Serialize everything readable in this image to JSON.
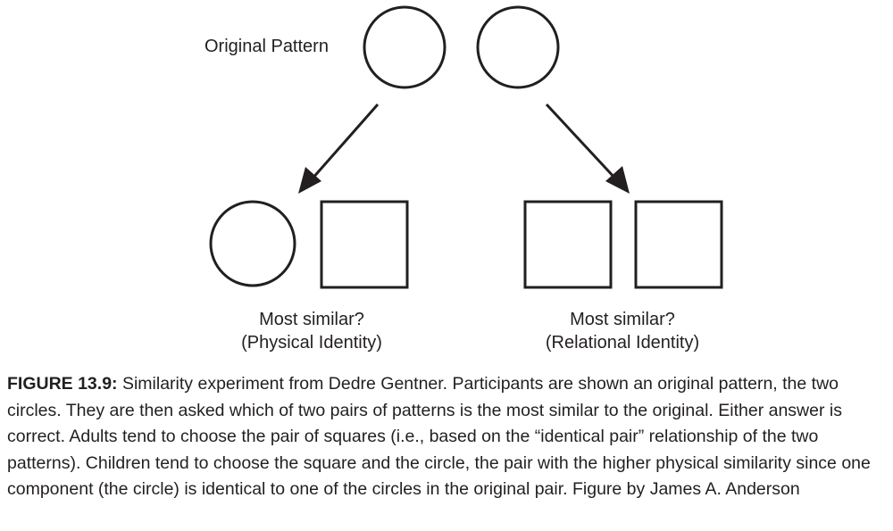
{
  "diagram": {
    "original_label": "Original Pattern",
    "left_option": {
      "line1": "Most similar?",
      "line2": "(Physical Identity)"
    },
    "right_option": {
      "line1": "Most similar?",
      "line2": "(Relational Identity)"
    }
  },
  "caption": {
    "label": "FIGURE 13.9:",
    "text": "Similarity experiment from Dedre Gentner. Participants are shown an original pattern, the two circles. They are then asked which of two pairs of patterns is the most similar to the original. Either answer is correct. Adults tend to choose the pair of squares (i.e., based on the “identical pair” relationship of the two patterns). Children tend to choose the square and the circle, the pair with the higher physical similarity since one component (the circle) is identical to one of the circles in the original pair. Figure by James A. Anderson"
  }
}
